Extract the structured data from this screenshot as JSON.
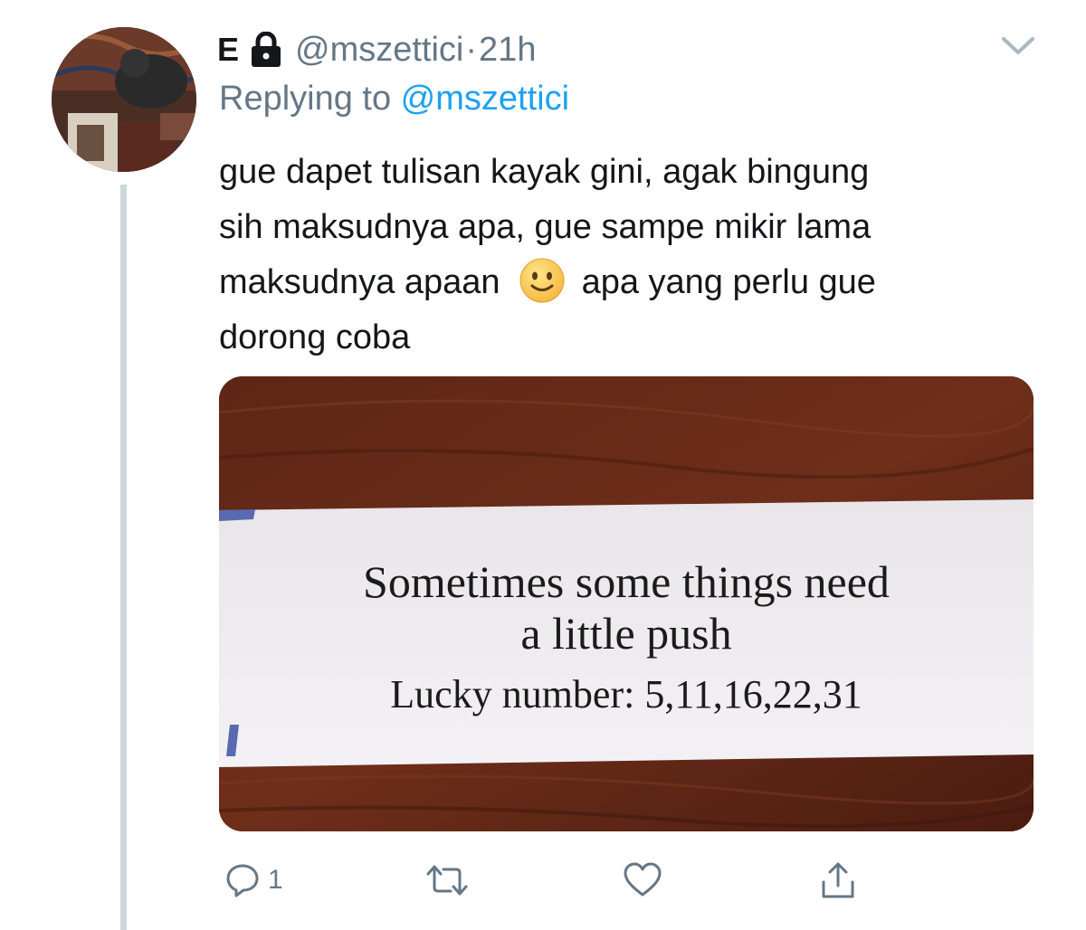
{
  "tweet": {
    "author_name": "E",
    "handle": "@mszettici",
    "separator": "·",
    "time": "21h",
    "replying_prefix": "Replying to ",
    "replying_to": "@mszettici",
    "text_lines": [
      "gue dapet tulisan kayak gini, agak bingung",
      "sih maksudnya apa, gue sampe mikir lama",
      "maksudnya apaan",
      "apa yang perlu gue",
      "dorong coba"
    ],
    "emoji": "slightly-smiling-face"
  },
  "media": {
    "fortune_line_1": "Sometimes some things need",
    "fortune_line_2": "a little push",
    "fortune_line_3": "Lucky number: 5,11,16,22,31"
  },
  "actions": {
    "reply_count": "1"
  },
  "colors": {
    "text": "#14171a",
    "secondary": "#657786",
    "link": "#1da1f2",
    "thread_line": "#ccd6dd"
  }
}
